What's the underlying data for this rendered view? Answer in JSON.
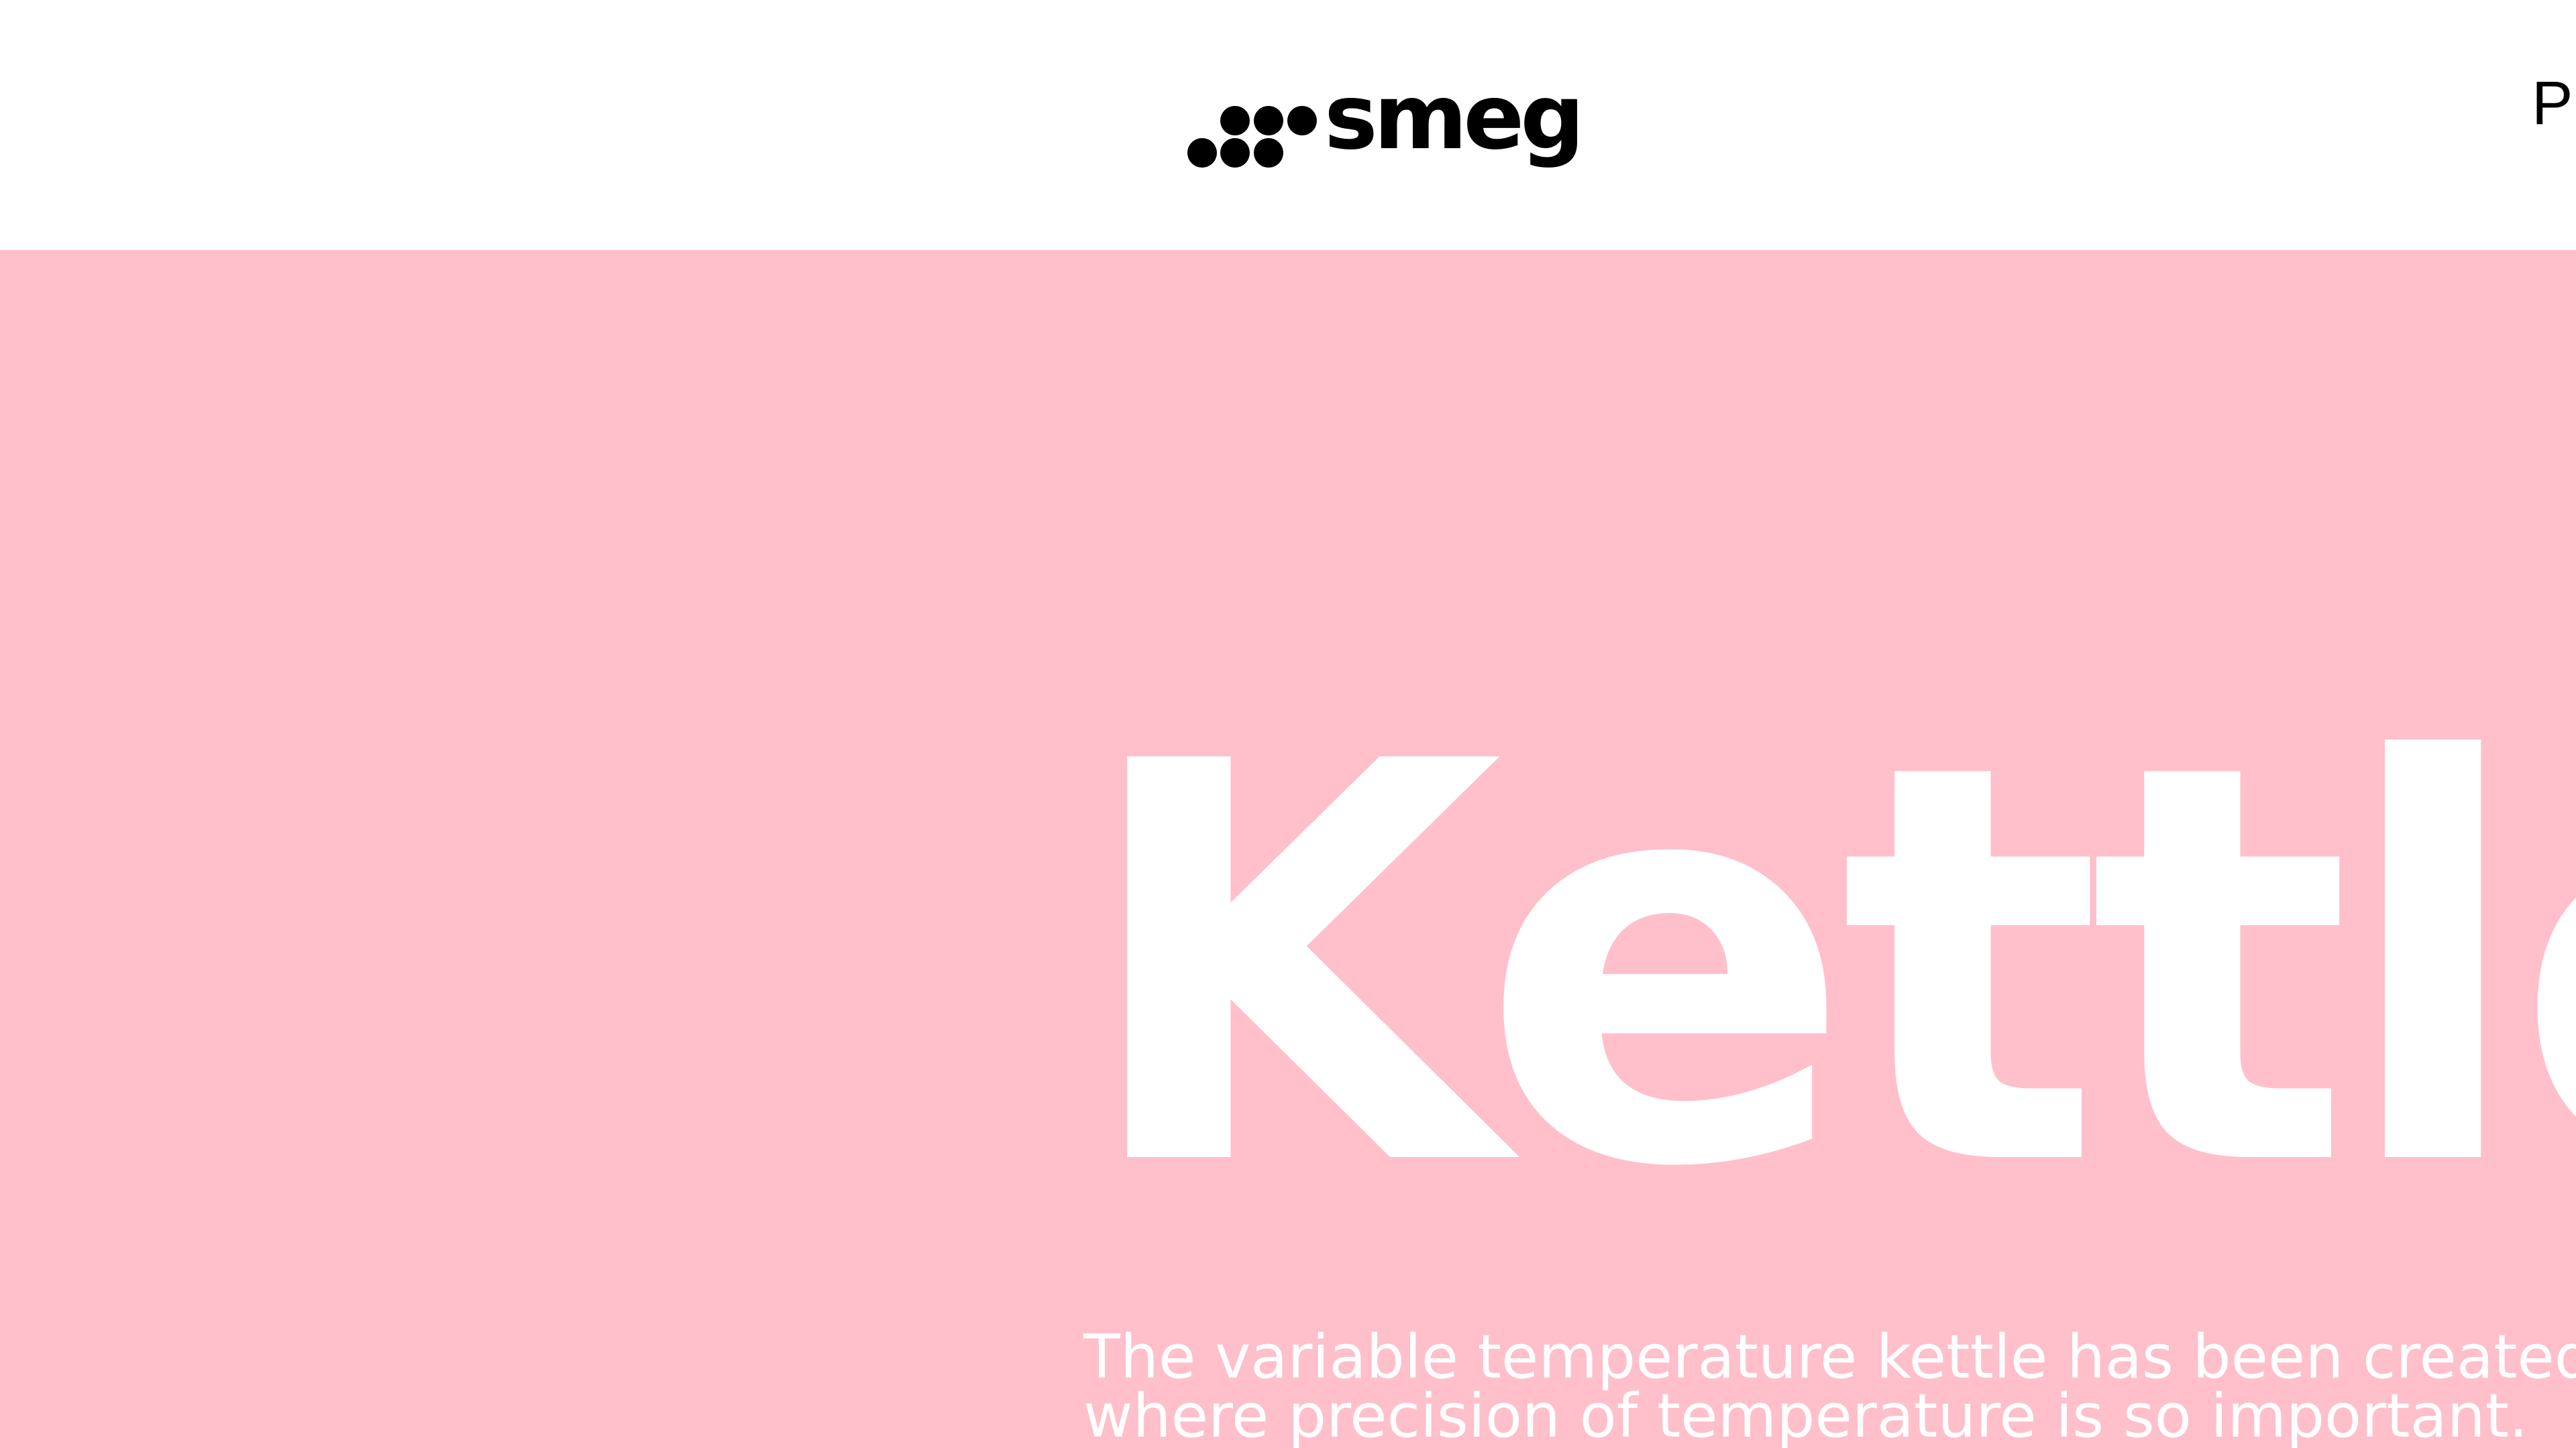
{
  "header": {
    "logo_text": "smeg",
    "nav_item_partial": "PI"
  },
  "hero": {
    "title": "Kettle",
    "description_lines": [
      "The variable temperature kettle has been created",
      "where precision of temperature is so important."
    ]
  },
  "colors": {
    "hero_background": "#ffbfcb",
    "header_background": "#ffffff",
    "hero_text": "#ffffff",
    "logo": "#000000"
  }
}
